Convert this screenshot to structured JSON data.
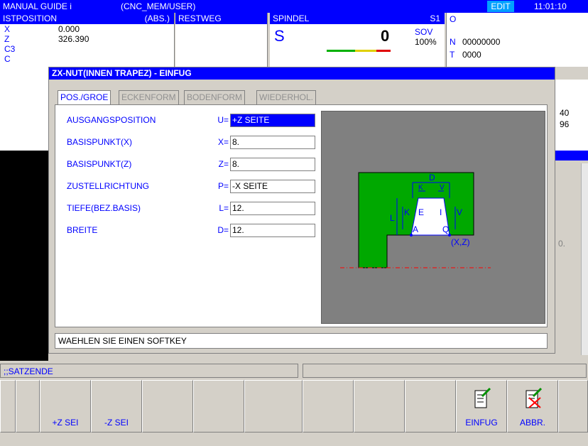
{
  "topbar": {
    "app": "MANUAL GUIDE i",
    "path": "(CNC_MEM/USER)",
    "mode": "EDIT",
    "time": "11:01:10"
  },
  "position": {
    "title": "ISTPOSITION",
    "mode": "(ABS.)",
    "axes": [
      {
        "name": "X",
        "value": "0.000"
      },
      {
        "name": "Z",
        "value": "326.390"
      },
      {
        "name": "C3",
        "value": ""
      },
      {
        "name": "C",
        "value": ""
      }
    ]
  },
  "restweg": {
    "title": "RESTWEG"
  },
  "spindle": {
    "title": "SPINDEL",
    "id": "S1",
    "s_label": "S",
    "s_value": "0",
    "sov_label": "SOV",
    "sov_value": "100%"
  },
  "codes": {
    "o_label": "O",
    "n_label": "N",
    "n_value": "00000000",
    "t_label": "T",
    "t_value": "0000",
    "bg_value_1": "40",
    "bg_value_2": "96",
    "bg_value_3": "0."
  },
  "dialog": {
    "title": "ZX-NUT(INNEN TRAPEZ) - EINFUG",
    "tabs": [
      "POS./GROE",
      "ECKENFORM",
      "BODENFORM",
      "WIEDERHOL."
    ],
    "fields": [
      {
        "label": "AUSGANGSPOSITION",
        "key": "U=",
        "value": "+Z SEITE"
      },
      {
        "label": "BASISPUNKT(X)",
        "key": "X=",
        "value": "8."
      },
      {
        "label": "BASISPUNKT(Z)",
        "key": "Z=",
        "value": "8."
      },
      {
        "label": "ZUSTELLRICHTUNG",
        "key": "P=",
        "value": "-X SEITE"
      },
      {
        "label": "TIEFE(BEZ.BASIS)",
        "key": "L=",
        "value": "12."
      },
      {
        "label": "BREITE",
        "key": "D=",
        "value": "12."
      }
    ],
    "status": "WAEHLEN SIE EINEN SOFTKEY",
    "diagram_labels": {
      "d": "D",
      "k_top": "K",
      "v_top": "V",
      "l": "L",
      "k": "K",
      "e": "E",
      "i": "I",
      "v": "V",
      "a": "A",
      "q": "Q",
      "xz": "(X,Z)"
    }
  },
  "program_line": ";;SATZENDE",
  "softkeys": [
    "",
    "+Z SEI",
    "-Z SEI",
    "",
    "",
    "",
    "",
    "",
    "",
    "EINFUG",
    "ABBR.",
    ""
  ],
  "colors": {
    "accent": "#0000ff",
    "mode_badge": "#00a0ff",
    "workpiece": "#00aa00",
    "diagram_bg": "#808080"
  },
  "icons": {
    "einfug": "insert-document-icon",
    "abbr": "cancel-document-icon"
  }
}
